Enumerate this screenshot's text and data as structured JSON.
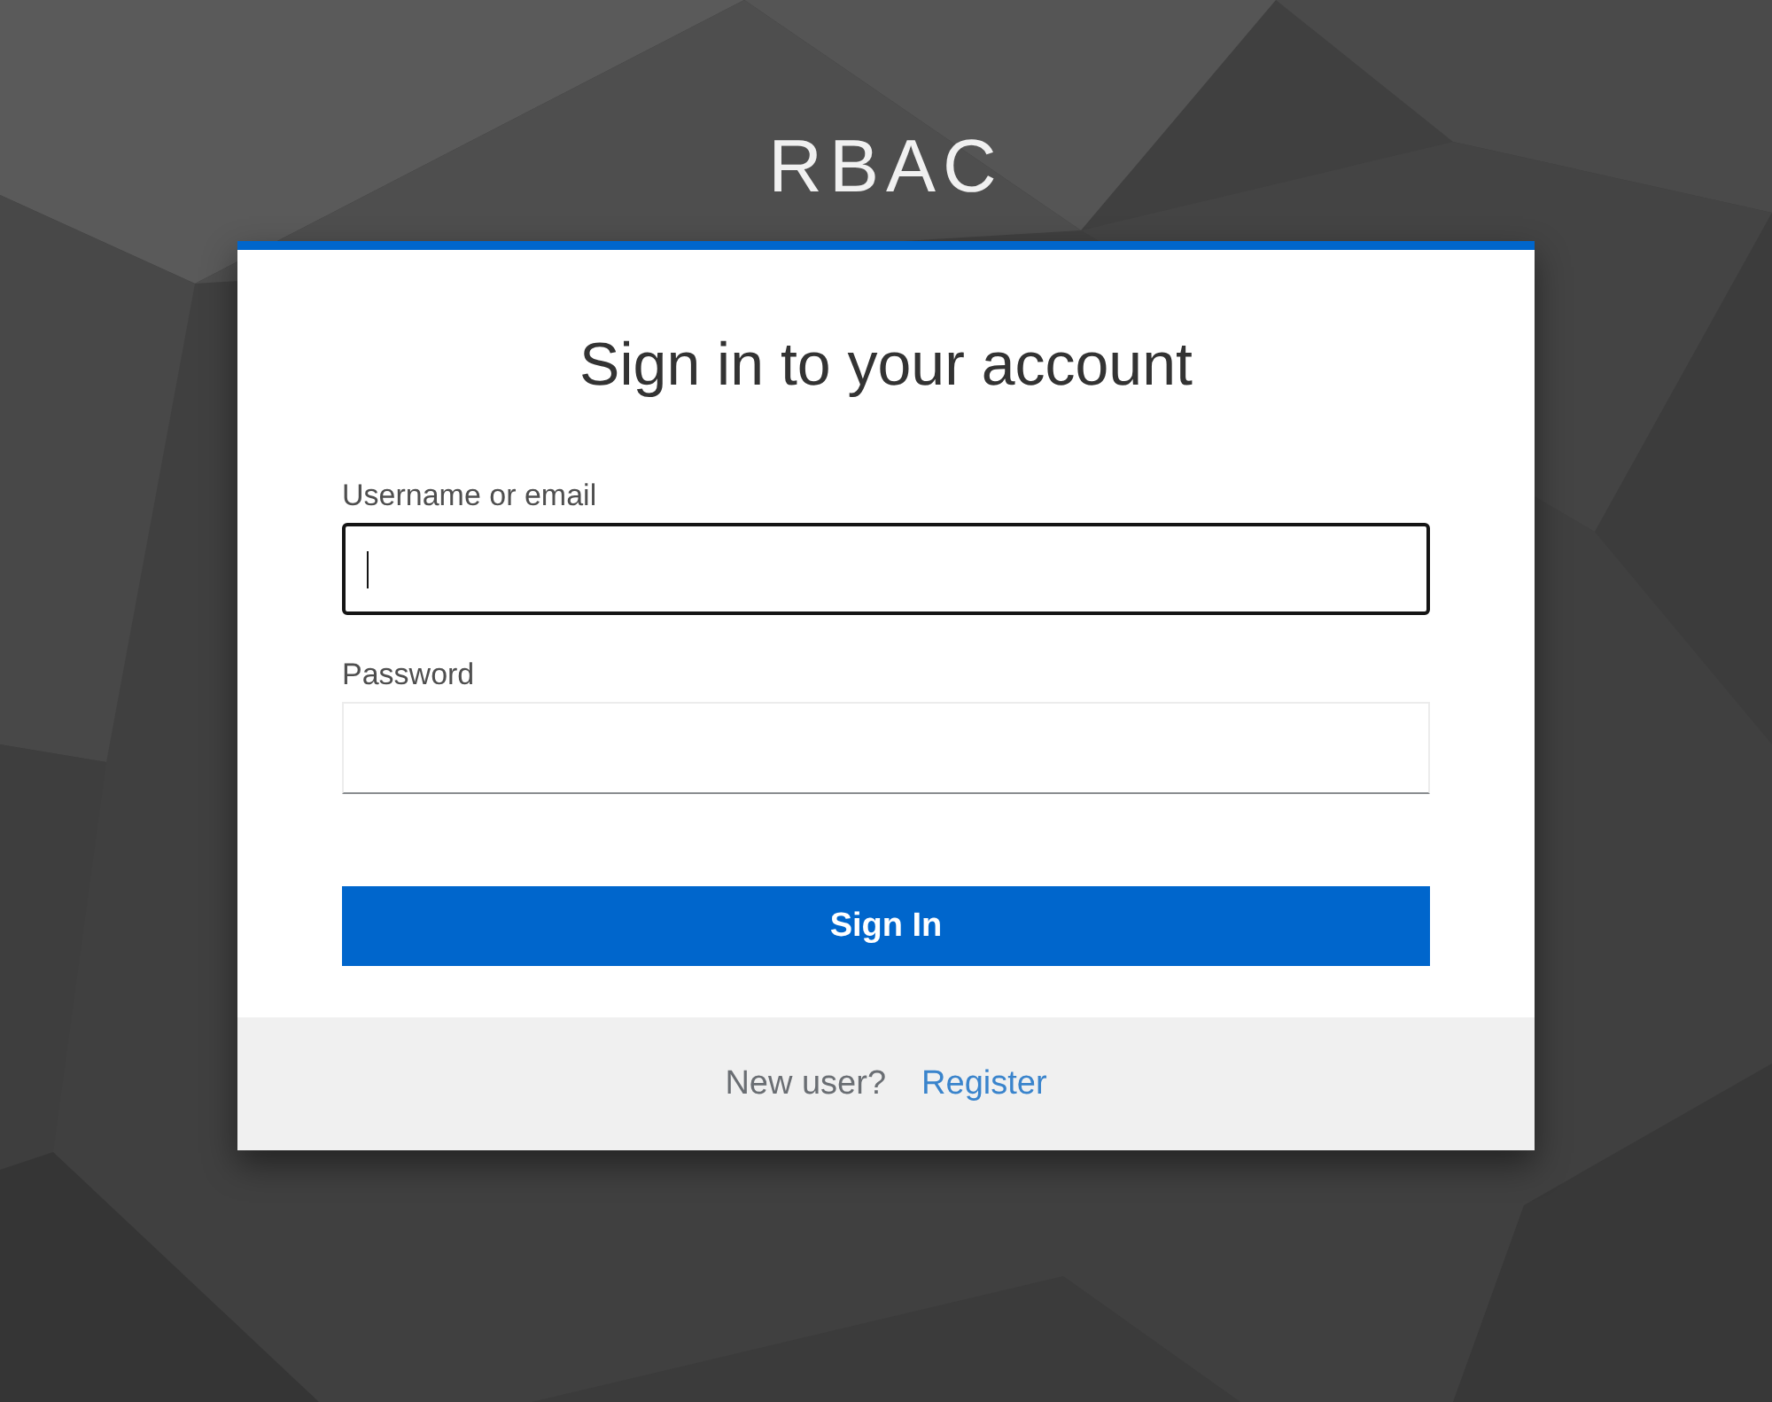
{
  "brand": {
    "title": "RBAC"
  },
  "card": {
    "heading": "Sign in to your account",
    "fields": [
      {
        "label": "Username or email",
        "focused": true
      },
      {
        "label": "Password",
        "focused": false
      }
    ],
    "submit": {
      "label": "Sign In"
    },
    "footer": {
      "prompt": "New user?",
      "link": "Register"
    }
  }
}
